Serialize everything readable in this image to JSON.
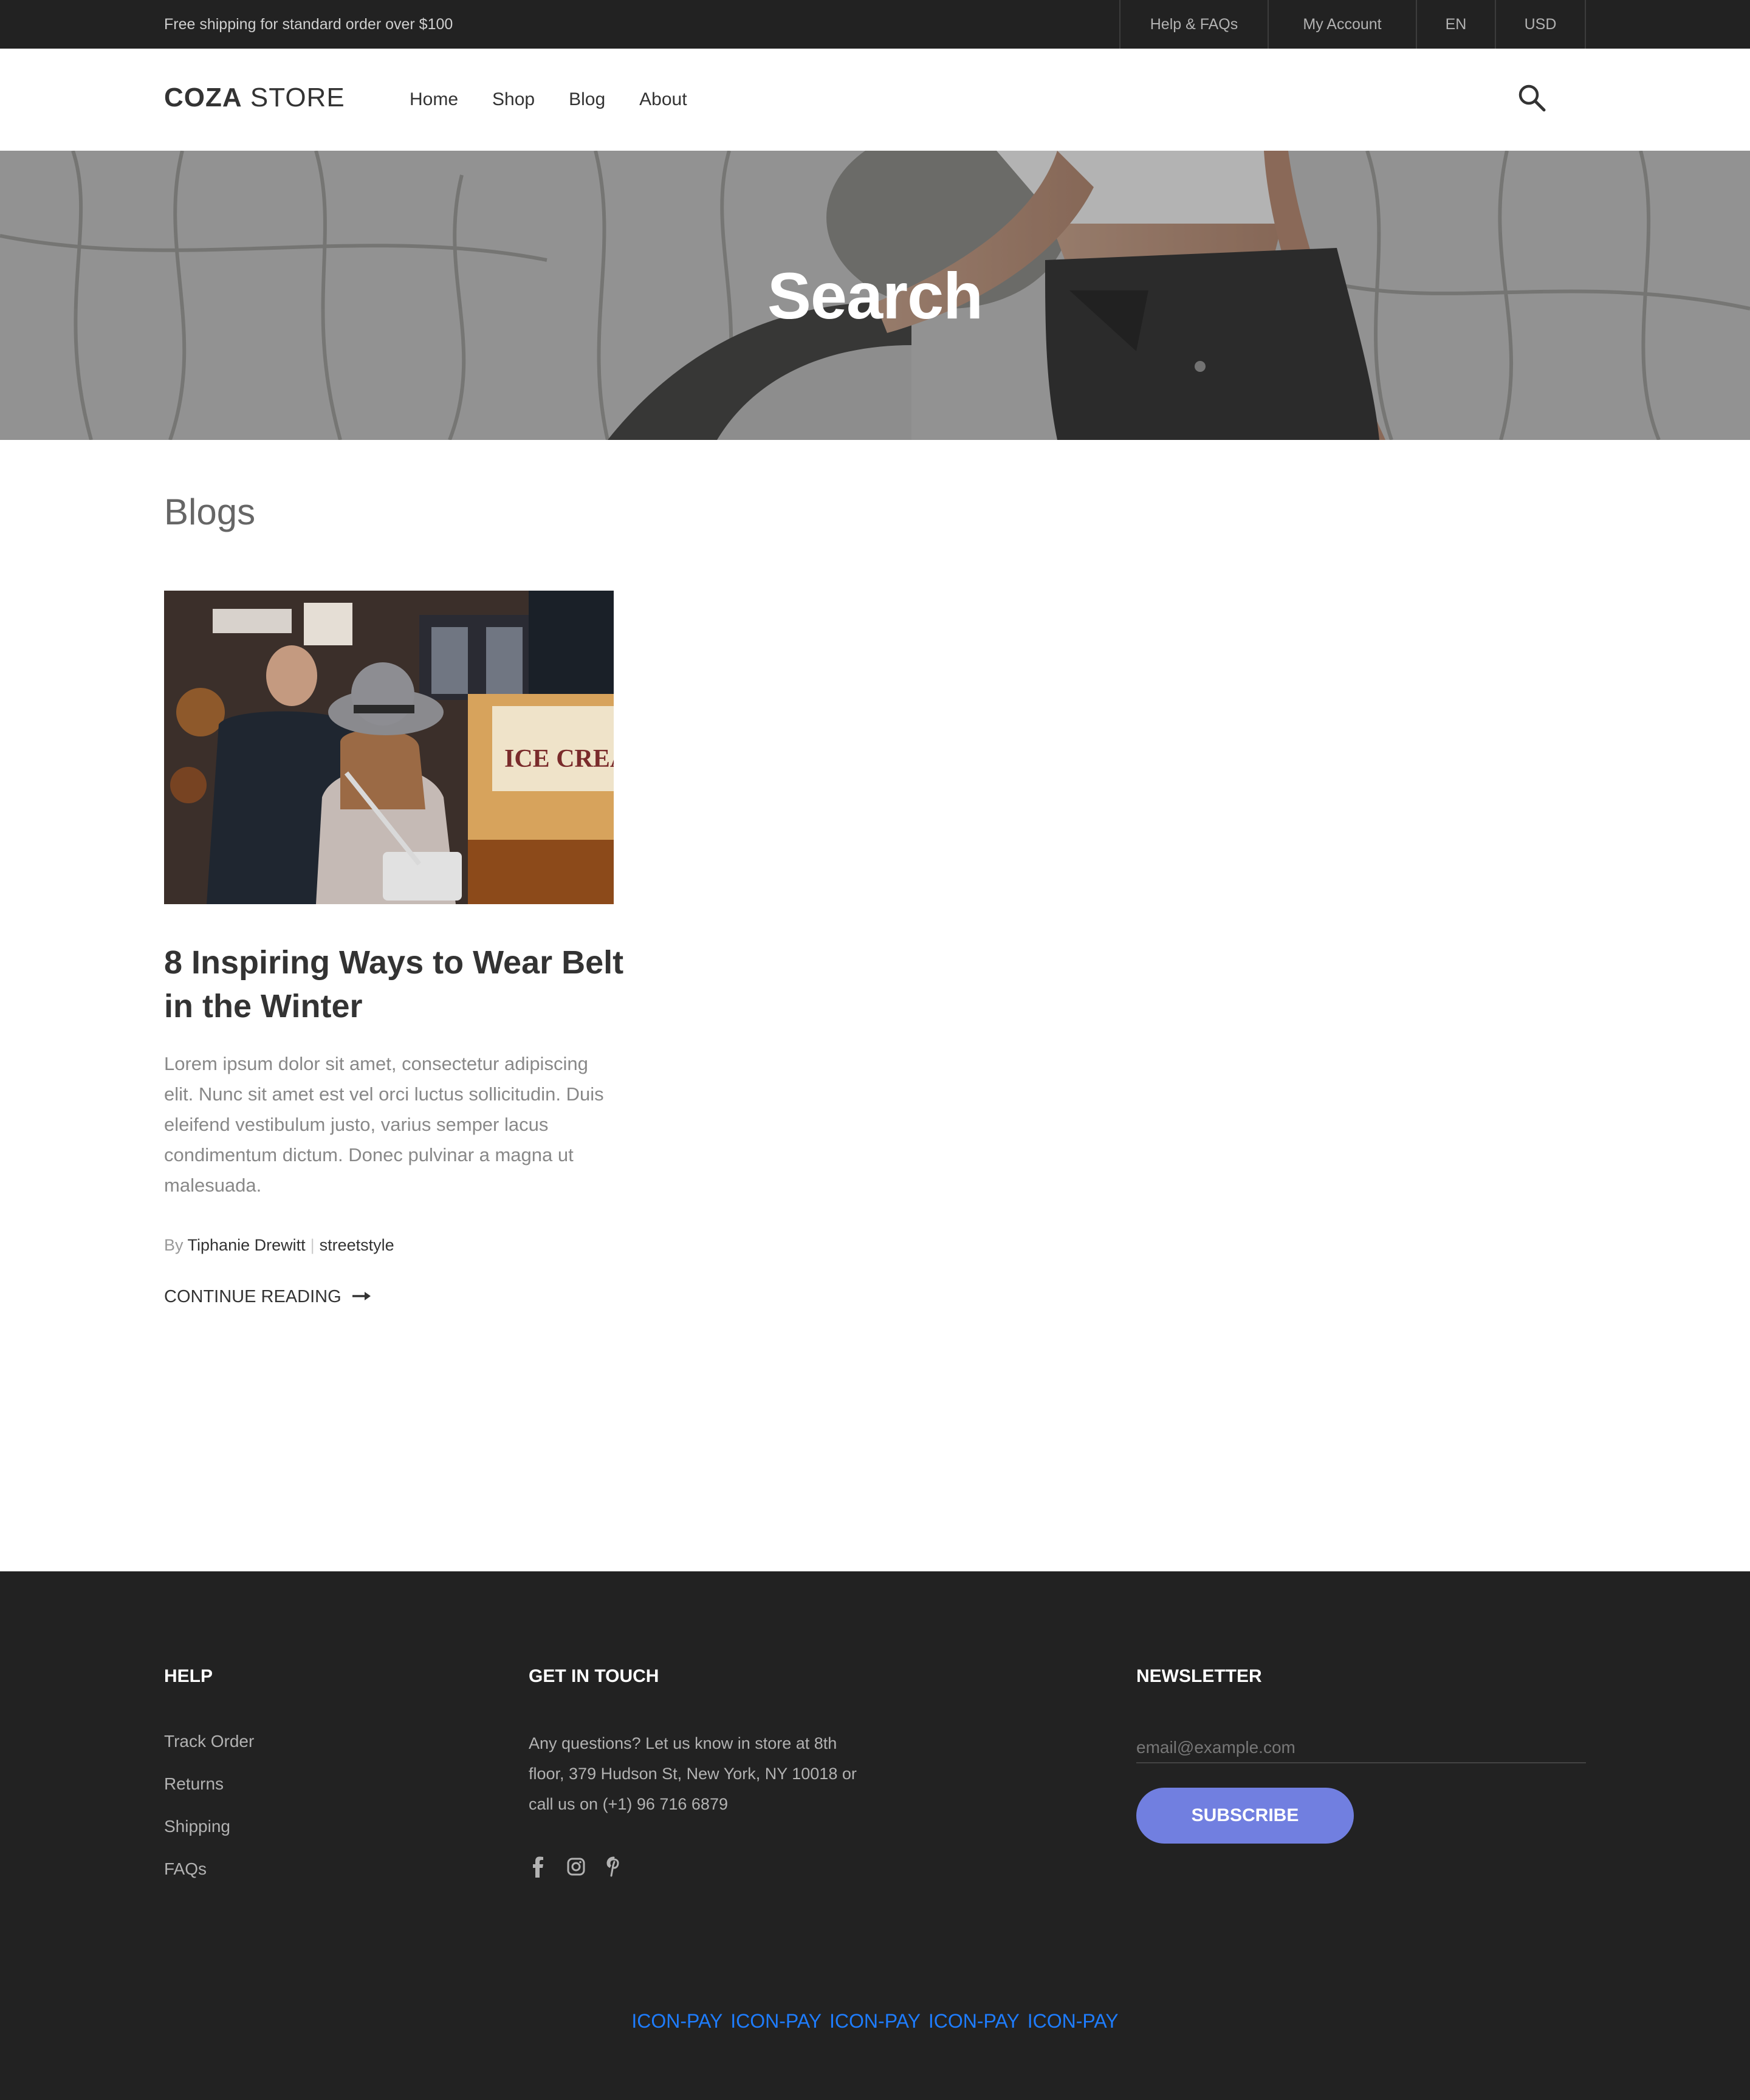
{
  "topbar": {
    "promo": "Free shipping for standard order over $100",
    "links": [
      "Help & FAQs",
      "My Account",
      "EN",
      "USD"
    ]
  },
  "header": {
    "logo_bold": "COZA",
    "logo_light": "STORE",
    "nav": [
      "Home",
      "Shop",
      "Blog",
      "About"
    ],
    "search_icon": "search-icon"
  },
  "hero": {
    "title": "Search"
  },
  "blogs": {
    "section_title": "Blogs",
    "post": {
      "title": "8 Inspiring Ways to Wear Belt in the Winter",
      "excerpt": "Lorem ipsum dolor sit amet, consectetur adipiscing elit. Nunc sit amet est vel orci luctus sollicitudin. Duis eleifend vestibulum justo, varius semper lacus condimentum dictum. Donec pulvinar a magna ut malesuada.",
      "by": "By",
      "author": "Tiphanie Drewitt",
      "tag": "streetstyle",
      "continue_label": "CONTINUE READING"
    }
  },
  "footer": {
    "help": {
      "heading": "HELP",
      "links": [
        "Track Order",
        "Returns",
        "Shipping",
        "FAQs"
      ]
    },
    "contact": {
      "heading": "GET IN TOUCH",
      "text": "Any questions? Let us know in store at 8th floor, 379 Hudson St, New York, NY 10018 or call us on (+1) 96 716 6879",
      "social": [
        "facebook-icon",
        "instagram-icon",
        "pinterest-icon"
      ]
    },
    "newsletter": {
      "heading": "NEWSLETTER",
      "placeholder": "email@example.com",
      "button": "SUBSCRIBE"
    },
    "payments": [
      "ICON-PAY",
      "ICON-PAY",
      "ICON-PAY",
      "ICON-PAY",
      "ICON-PAY"
    ]
  },
  "colors": {
    "dark": "#222222",
    "accent": "#717fe0",
    "link_blue": "#1e7dff"
  }
}
